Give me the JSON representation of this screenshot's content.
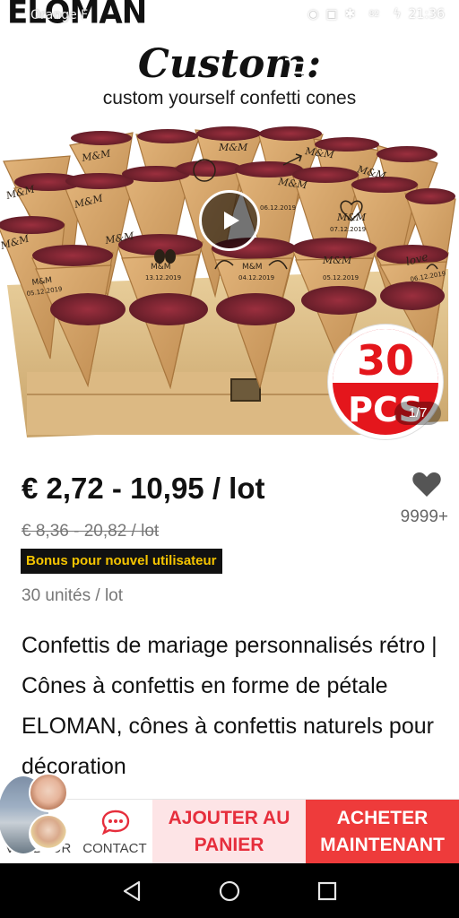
{
  "status_bar": {
    "carrier": "Orange F",
    "time": "21:36",
    "battery": "82"
  },
  "brand_logo": "ELOMAN",
  "hero": {
    "title": "Custom:",
    "subtitle": "custom yourself confetti cones",
    "badge_number": "30",
    "badge_unit": "PCS",
    "image_counter": "1/7",
    "cone_labels": [
      "M&M",
      "M&M",
      "M&M",
      "M&M",
      "M&M",
      "M&M",
      "M&M",
      "M&M",
      "M&M",
      "M&M",
      "love"
    ],
    "cone_dates": [
      "05.12.2019",
      "13.12.2019",
      "04.12.2019",
      "07.12.2019",
      "05.12.2019",
      "06.12.2019"
    ]
  },
  "nav": {
    "back_icon": "arrow-left-icon",
    "cart_icon": "cart-icon",
    "share_icon": "share-icon",
    "more_icon": "more-vertical-icon"
  },
  "product": {
    "price": "€ 2,72 - 10,95 / lot",
    "old_price": "€ 8,36 - 20,82 / lot",
    "bonus": "Bonus pour nouvel utilisateur",
    "units": "30 unités / lot",
    "wish_count": "9999+",
    "title": "Confettis de mariage personnalisés rétro | Cônes à confettis en forme de pétale ELOMAN, cônes à confettis naturels pour décoration"
  },
  "actions": {
    "seller_label": "VENDEUR",
    "contact_label": "CONTACT",
    "add_to_cart": "AJOUTER AU PANIER",
    "buy_now": "ACHETER MAINTENANT"
  },
  "colors": {
    "accent_red": "#ee3b3b",
    "cart_bg": "#fde4e6",
    "bonus_yellow": "#f5c400"
  }
}
